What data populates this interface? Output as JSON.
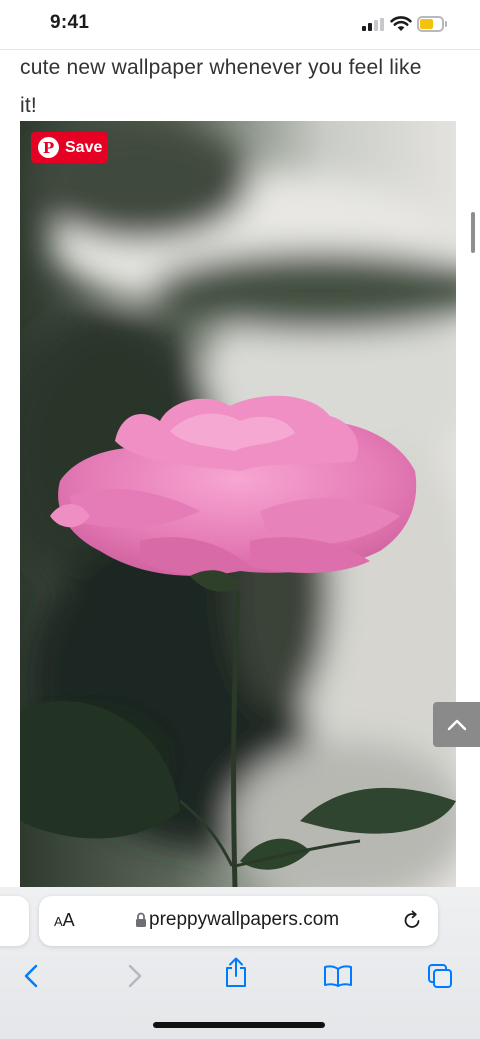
{
  "status_bar": {
    "time": "9:41"
  },
  "article": {
    "line1": "cute new wallpaper whenever you feel like",
    "line2": "it!"
  },
  "pin_button": {
    "label": "Save",
    "logo": "P"
  },
  "browser": {
    "text_size_button": {
      "small": "A",
      "large": "A"
    },
    "url": "preppywallpapers.com"
  },
  "icons": {
    "back": "chevron-left-icon",
    "forward": "chevron-right-icon",
    "share": "share-icon",
    "bookmarks": "book-icon",
    "tabs": "tabs-icon",
    "reload": "reload-icon",
    "lock": "lock-icon",
    "back_to_top": "chevron-up-icon"
  },
  "colors": {
    "accent": "#007aff",
    "pinterest_red": "#e60023",
    "battery": "#f4c20d"
  }
}
